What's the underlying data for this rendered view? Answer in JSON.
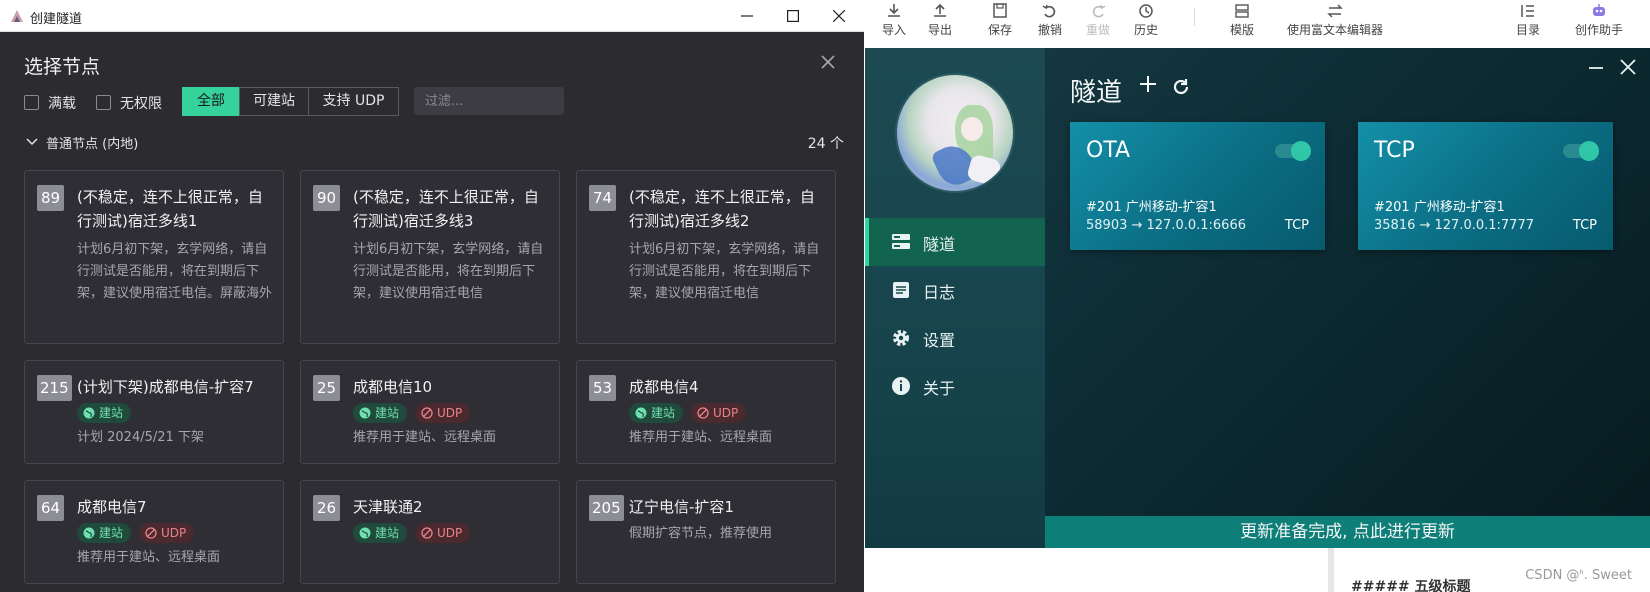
{
  "editor": {
    "toolbar": [
      "导入",
      "导出",
      "保存",
      "撤销",
      "重做",
      "历史",
      "模版",
      "使用富文本编辑器",
      "目录",
      "创作助手"
    ],
    "heading_snippet": "##### 五级标题",
    "watermark": "CSDN @ᑋ. Sweet"
  },
  "dialog": {
    "window_title": "创建隧道",
    "heading": "选择节点",
    "checkboxes": [
      "满载",
      "无权限"
    ],
    "segments": [
      "全部",
      "可建站",
      "支持 UDP"
    ],
    "active_segment": "全部",
    "filter_placeholder": "过滤...",
    "group": {
      "title": "普通节点 (内地)",
      "count": "24 个"
    },
    "nodes": [
      {
        "id": "89",
        "name": "(不稳定，连不上很正常，自行测试)宿迁多线1",
        "desc": "计划6月初下架，玄学网络，请自行测试是否能用，将在到期后下架，建议使用宿迁电信。屏蔽海外",
        "tags": []
      },
      {
        "id": "90",
        "name": "(不稳定，连不上很正常，自行测试)宿迁多线3",
        "desc": "计划6月初下架，玄学网络，请自行测试是否能用，将在到期后下架，建议使用宿迁电信",
        "tags": []
      },
      {
        "id": "74",
        "name": "(不稳定，连不上很正常，自行测试)宿迁多线2",
        "desc": "计划6月初下架，玄学网络，请自行测试是否能用，将在到期后下架，建议使用宿迁电信",
        "tags": []
      },
      {
        "id": "215",
        "name": "(计划下架)成都电信-扩容7",
        "desc": "计划 2024/5/21 下架",
        "tags": [
          "建站"
        ]
      },
      {
        "id": "25",
        "name": "成都电信10",
        "desc": "推荐用于建站、远程桌面",
        "tags": [
          "建站",
          "UDP"
        ]
      },
      {
        "id": "53",
        "name": "成都电信4",
        "desc": "推荐用于建站、远程桌面",
        "tags": [
          "建站",
          "UDP"
        ]
      },
      {
        "id": "64",
        "name": "成都电信7",
        "desc": "推荐用于建站、远程桌面",
        "tags": [
          "建站",
          "UDP"
        ]
      },
      {
        "id": "26",
        "name": "天津联通2",
        "desc": "",
        "tags": [
          "建站",
          "UDP"
        ]
      },
      {
        "id": "205",
        "name": "辽宁电信-扩容1",
        "desc": "假期扩容节点，推荐使用",
        "tags": []
      }
    ]
  },
  "app": {
    "nav": [
      "隧道",
      "日志",
      "设置",
      "关于"
    ],
    "active_nav": "隧道",
    "page_title": "隧道",
    "tunnels": [
      {
        "name": "OTA",
        "enabled": true,
        "node": "#201 广州移动-扩容1",
        "mapping": "58903 → 127.0.0.1:6666",
        "protocol": "TCP"
      },
      {
        "name": "TCP",
        "enabled": true,
        "node": "#201 广州移动-扩容1",
        "mapping": "35816 → 127.0.0.1:7777",
        "protocol": "TCP"
      }
    ],
    "update_banner": "更新准备完成, 点此进行更新"
  },
  "colors": {
    "accent": "#35d39b",
    "card": "#0b6d83",
    "sidebar_active": "#13644e",
    "banner": "#0e7e78",
    "dialog_bg": "#2b2b30"
  }
}
